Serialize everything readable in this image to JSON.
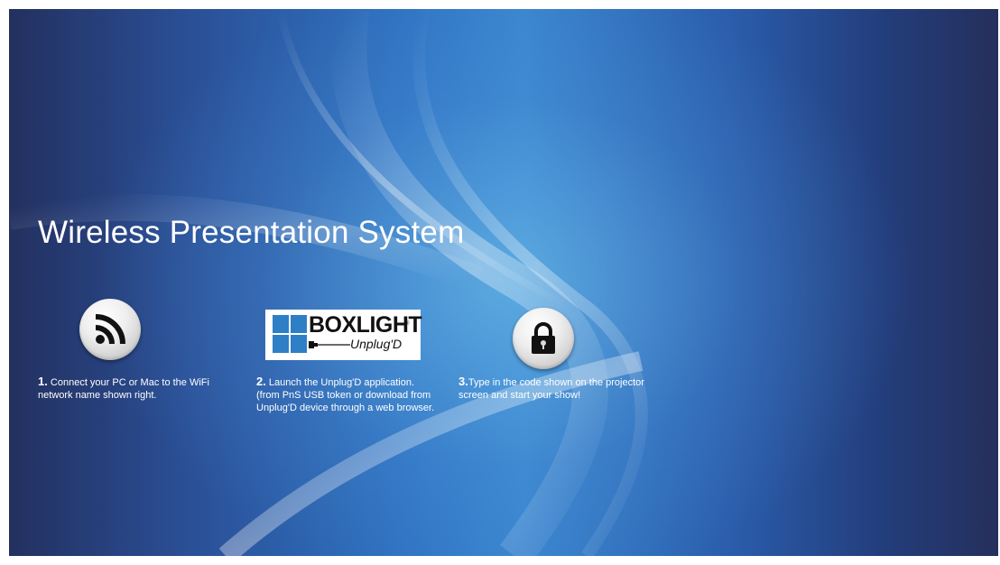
{
  "title": "Wireless Presentation System",
  "logo": {
    "brand": "BOXLIGHT",
    "registered": "®",
    "product": "Unplug'D",
    "brand_color": "#2f7fc6"
  },
  "steps": [
    {
      "number": "1.",
      "icon": "rss-icon",
      "line1": " Connect your PC or Mac to the WiFi",
      "line2": "network name shown right."
    },
    {
      "number": "2.",
      "icon": "boxlight-unplugd-logo",
      "line1": " Launch the Unplug'D application.",
      "line2": "(from PnS USB token or download from",
      "line3": "Unplug'D device through a web browser."
    },
    {
      "number": "3.",
      "icon": "lock-icon",
      "line1": "Type in the code shown on the projector",
      "line2": "screen and start your show!"
    }
  ]
}
